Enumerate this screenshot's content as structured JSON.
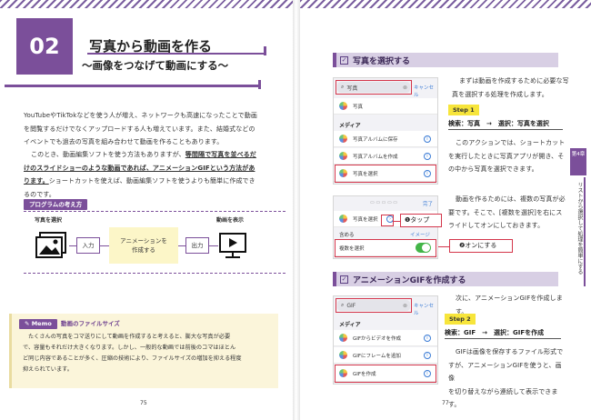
{
  "left_page": {
    "chapter_number": "02",
    "title": "写真から動画を作る",
    "subtitle": "〜画像をつなげて動画にする〜",
    "para1": [
      "YouTubeやTikTokなどを使う人が増え、ネットワークも高速になったことで動画",
      "を閲覧するだけでなくアップロードする人も増えています。また、結婚式などの",
      "イベントでも過去の写真を組み合わせて動画を作ることもあります。"
    ],
    "para2_l1": "このとき、動画編集ソフトを使う方法もありますが、",
    "para2_l1b": "等間隔で写真を並べるだ",
    "para2_l2a": "けのスライドショーのような動画であれば、アニメーションGIFという方法があ",
    "para2_l3a": "ります。",
    "para2_l3b": "ショートカットを使えば、動画編集ソフトを使うよりも簡単に作成でき",
    "para2_l4": "るのです。",
    "program_tag": "プログラムの考え方",
    "label_select": "写真を選択",
    "label_display": "動画を表示",
    "flow_input": "入力",
    "flow_process": "アニメーションを作成する",
    "flow_output": "出力",
    "memo_tag": "Memo",
    "memo_title": "動画のファイルサイズ",
    "memo_text": [
      "たくさんの写真をコマ送りにして動画を作成すると考えると、膨大な写真が必要",
      "で、容量もそれだけ大きくなります。しかし、一般的な動画では前後のコマはほとん",
      "ど同じ内容であることが多く、圧縮の技術により、ファイルサイズの増加を抑える程度",
      "抑えられています。"
    ],
    "page_number": "75"
  },
  "right_page": {
    "section1_title": "写真を選択する",
    "section1_text": [
      "まずは動画を作成するために必要な写",
      "真を選択する処理を作成します。"
    ],
    "step1": "Step 1",
    "step1_action": "検索：写真　→　選択：写真を選択",
    "step1_text": [
      "このアクションでは、ショートカット",
      "を実行したときに写真アプリが開き、そ",
      "の中から写真を選択できます。"
    ],
    "multi_text": [
      "動画を作るためには、複数の写真が必",
      "要です。そこで、[複数を選択]を右にス",
      "ライドしてオンにしておきます。"
    ],
    "phone1": {
      "search_value": "写真",
      "cancel": "キャンセル",
      "item_photos": "写真",
      "media_label": "メディア",
      "items": [
        "写真アルバムに保存",
        "写真アルバムを作成",
        "写真を選択"
      ]
    },
    "phone2": {
      "done": "完了",
      "item": "写真を選択",
      "include": "含める",
      "image": "イメージ",
      "multi": "複数を選択"
    },
    "callout1": "❶タップ",
    "callout2": "❷オンにする",
    "section2_title": "アニメーションGIFを作成する",
    "section2_text": "次に、アニメーションGIFを作成します。",
    "step2": "Step 2",
    "step2_action": "検索：GIF　→　選択：GIFを作成",
    "step2_text": [
      "GIFは画像を保存するファイル形式で",
      "すが、アニメーションGIFを使うと、画像",
      "を切り替えながら連続して表示できます。"
    ],
    "phone3": {
      "search_value": "GIF",
      "cancel": "キャンセル",
      "media_label": "メディア",
      "items": [
        "GIFからビデオを作成",
        "GIFにフレームを追加",
        "GIFを作成"
      ]
    },
    "side_tab": "第4章",
    "side_text": "リストから選択して処理を簡単にする",
    "page_number": "77"
  },
  "colors": {
    "accent": "#7b4f9a",
    "highlight": "#f7e53b",
    "red": "#d4364b"
  }
}
